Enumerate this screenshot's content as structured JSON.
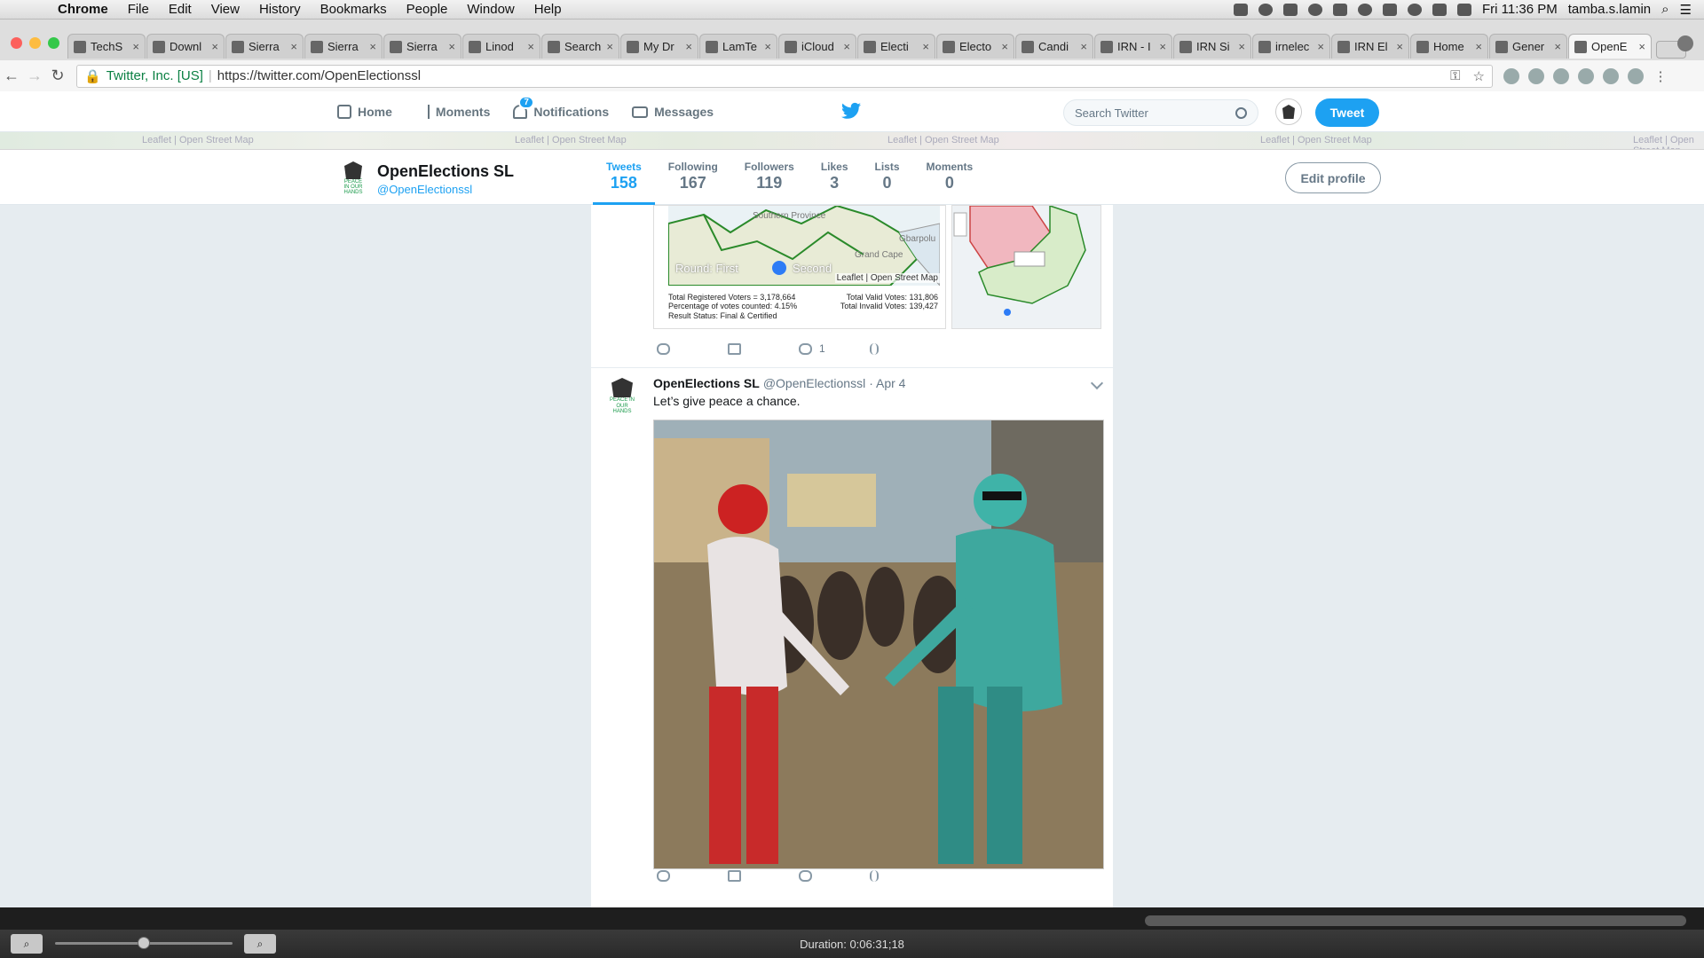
{
  "menubar": {
    "app": "Chrome",
    "items": [
      "File",
      "Edit",
      "View",
      "History",
      "Bookmarks",
      "People",
      "Window",
      "Help"
    ],
    "clock": "Fri 11:36 PM",
    "user": "tamba.s.lamin"
  },
  "tabs": [
    {
      "title": "TechS"
    },
    {
      "title": "Downl"
    },
    {
      "title": "Sierra"
    },
    {
      "title": "Sierra"
    },
    {
      "title": "Sierra"
    },
    {
      "title": "Linod"
    },
    {
      "title": "Search"
    },
    {
      "title": "My Dr"
    },
    {
      "title": "LamTe"
    },
    {
      "title": "iCloud"
    },
    {
      "title": "Electi"
    },
    {
      "title": "Electo"
    },
    {
      "title": "Candi"
    },
    {
      "title": "IRN - I"
    },
    {
      "title": "IRN Si"
    },
    {
      "title": "irnelec"
    },
    {
      "title": "IRN El"
    },
    {
      "title": "Home"
    },
    {
      "title": "Gener"
    },
    {
      "title": "OpenE",
      "active": true
    }
  ],
  "omnibox": {
    "site": "Twitter, Inc. [US]",
    "url": "https://twitter.com/OpenElectionssl"
  },
  "twitter_nav": {
    "home": "Home",
    "moments": "Moments",
    "notifications": "Notifications",
    "notif_count": "7",
    "messages": "Messages",
    "search_placeholder": "Search Twitter",
    "tweet_button": "Tweet"
  },
  "banner_text": "Leaflet | Open Street Map",
  "profile": {
    "name": "OpenElections SL",
    "handle": "@OpenElectionssl",
    "avatar_label": "PEACE IN OUR HANDS",
    "edit_button": "Edit profile",
    "stats": [
      {
        "label": "Tweets",
        "value": "158",
        "active": true
      },
      {
        "label": "Following",
        "value": "167"
      },
      {
        "label": "Followers",
        "value": "119"
      },
      {
        "label": "Likes",
        "value": "3"
      },
      {
        "label": "Lists",
        "value": "0"
      },
      {
        "label": "Moments",
        "value": "0"
      }
    ]
  },
  "tweet1": {
    "map": {
      "province_label": "Southern Province",
      "place1": "Gbarpolu",
      "place2": "Grand Cape",
      "round_label": "Round: First",
      "second_label": "Second",
      "attribution": "Leaflet | Open Street Map",
      "stats_left": [
        "Total Registered Voters = 3,178,664",
        "Percentage of votes counted: 4.15%",
        "Result Status: Final & Certified"
      ],
      "stats_right": [
        "Total Valid Votes: 131,806",
        "Total Invalid Votes: 139,427"
      ]
    },
    "likes": "1"
  },
  "tweet2": {
    "name": "OpenElections SL",
    "handle": "@OpenElectionssl",
    "date": "· Apr 4",
    "text": "Let’s give peace a chance."
  },
  "quicktime": {
    "duration": "Duration: 0:06:31;18"
  }
}
